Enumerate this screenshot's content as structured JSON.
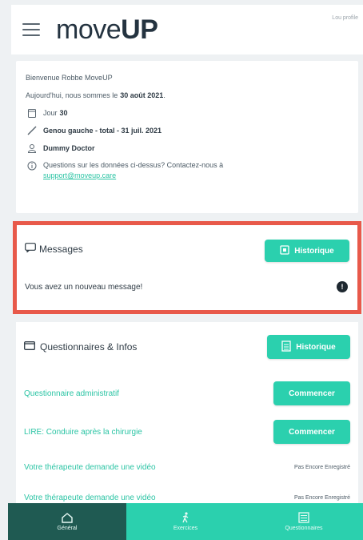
{
  "header": {
    "logo_part1": "move",
    "logo_part2": "UP",
    "corner_text": "Lou\nprofile"
  },
  "info": {
    "welcome": "Bienvenue Robbe MoveUP",
    "today_prefix": "Aujourd'hui, nous sommes le",
    "today_date": "30 août 2021",
    "day_label": "Jour",
    "day_value": "30",
    "surgery": "Genou gauche - total - 31 juil. 2021",
    "doctor": "Dummy Doctor",
    "question_text": "Questions sur les données ci-dessus? Contactez-nous à",
    "support_email": "support@moveup.care"
  },
  "messages": {
    "title": "Messages",
    "history_label": "Historique",
    "new_message": "Vous avez un nouveau message!",
    "badge": "!"
  },
  "questionnaires": {
    "title": "Questionnaires & Infos",
    "history_label": "Historique",
    "rows": [
      {
        "label": "Questionnaire administratif",
        "action": "Commencer"
      },
      {
        "label": "LIRE: Conduire après la chirurgie",
        "action": "Commencer"
      },
      {
        "label": "Votre thérapeute demande une vidéo",
        "status": "Pas Encore Enregistré"
      },
      {
        "label": "Votre thérapeute demande une vidéo",
        "status": "Pas Encore Enregistré"
      }
    ]
  },
  "nav": {
    "items": [
      {
        "label": "Général"
      },
      {
        "label": "Exercices"
      },
      {
        "label": "Questionnaires"
      }
    ]
  },
  "colors": {
    "accent": "#2bd0ae",
    "highlight": "#e8594a",
    "nav_active": "#1f5a52"
  }
}
